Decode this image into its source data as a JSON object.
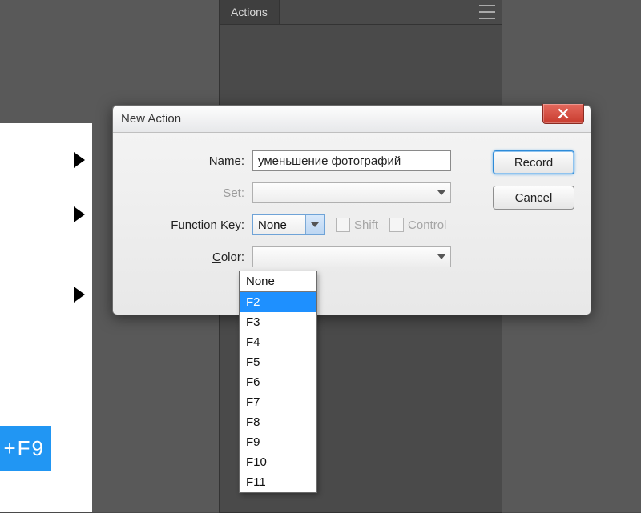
{
  "panel": {
    "title": "Actions"
  },
  "hint": "+F9",
  "dialog": {
    "title": "New Action",
    "labels": {
      "name_pre": "",
      "name_u": "N",
      "name_post": "ame:",
      "set_pre": "S",
      "set_u": "e",
      "set_post": "t:",
      "fkey_pre": "",
      "fkey_u": "F",
      "fkey_post": "unction Key:",
      "color_pre": "",
      "color_u": "C",
      "color_post": "olor:"
    },
    "name_value": "уменьшение фотографий",
    "set_value": "",
    "function_key_value": "None",
    "shift_label": "Shift",
    "control_label": "Control",
    "color_value": "",
    "buttons": {
      "record": "Record",
      "cancel": "Cancel"
    }
  },
  "fkey_options": [
    "None",
    "F2",
    "F3",
    "F4",
    "F5",
    "F6",
    "F7",
    "F8",
    "F9",
    "F10",
    "F11"
  ],
  "fkey_selected_index": 1
}
